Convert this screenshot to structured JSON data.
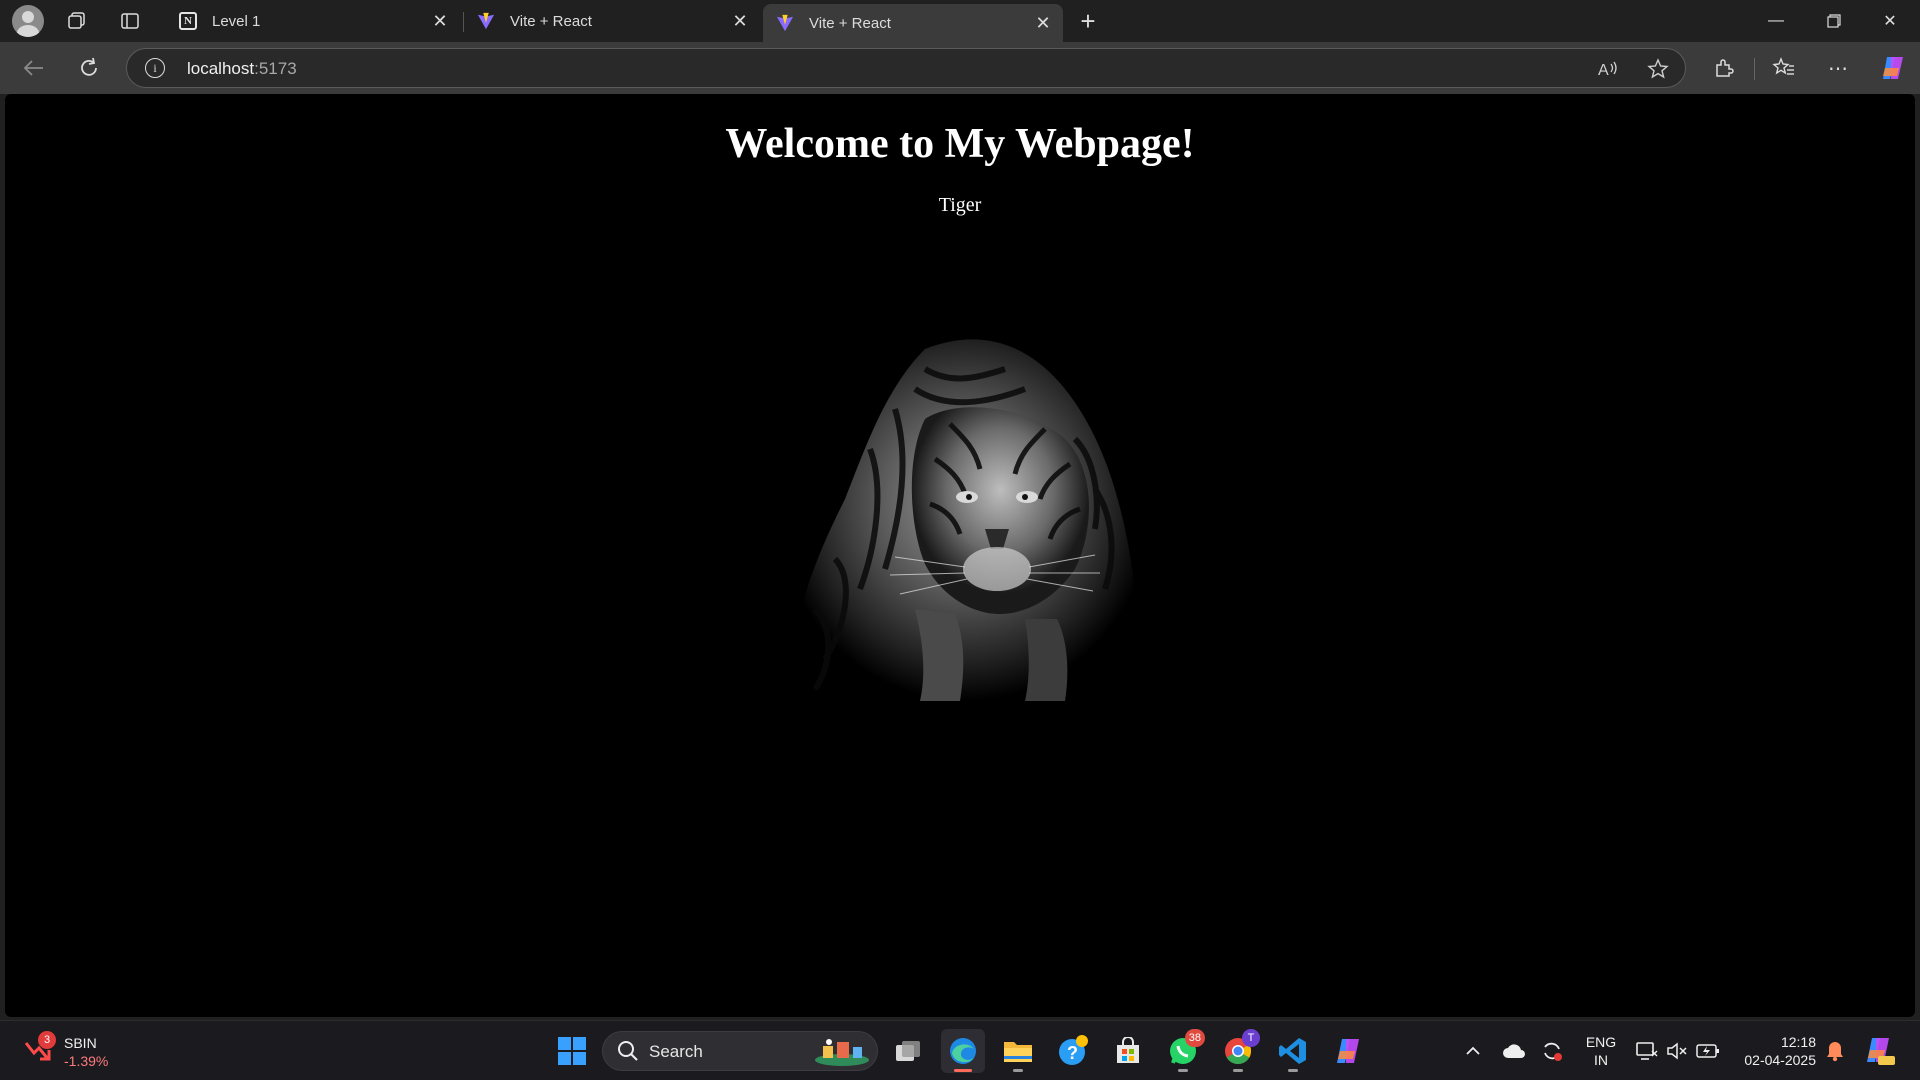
{
  "browser": {
    "tabs": [
      {
        "title": "Level 1",
        "favicon": "notion-icon",
        "active": false
      },
      {
        "title": "Vite + React",
        "favicon": "vite-icon",
        "active": false
      },
      {
        "title": "Vite + React",
        "favicon": "vite-icon",
        "active": true
      }
    ],
    "address": {
      "host": "localhost",
      "port": ":5173"
    }
  },
  "page": {
    "title": "Welcome to My Webpage!",
    "subtitle": "Tiger"
  },
  "taskbar": {
    "stock": {
      "badge": "3",
      "name": "SBIN",
      "change": "-1.39%"
    },
    "search_label": "Search",
    "whatsapp_badge": "38",
    "chrome_badge": "T",
    "lang_line1": "ENG",
    "lang_line2": "IN",
    "time": "12:18",
    "date": "02-04-2025"
  },
  "colors": {
    "page_background": "#000000",
    "page_text": "#ffffff",
    "accent_edge": "#ff6a5a"
  }
}
